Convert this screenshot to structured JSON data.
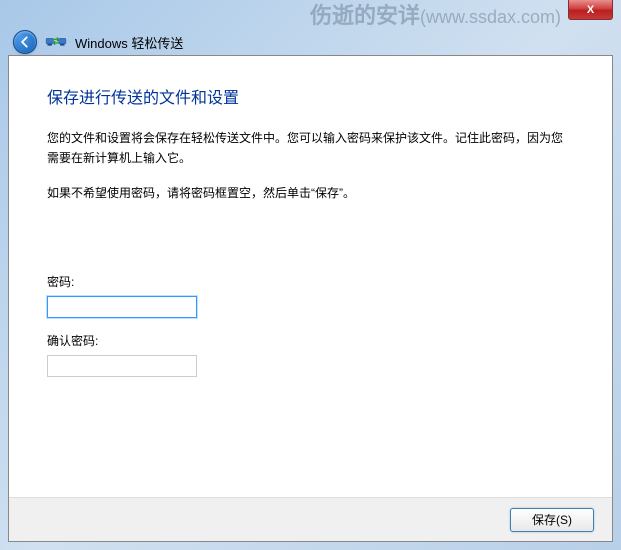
{
  "watermark": {
    "text": "伤逝的安详",
    "url": "(www.ssdax.com)"
  },
  "window": {
    "close_label": "X"
  },
  "toolbar": {
    "app_title": "Windows 轻松传送"
  },
  "content": {
    "heading": "保存进行传送的文件和设置",
    "para1": "您的文件和设置将会保存在轻松传送文件中。您可以输入密码来保护该文件。记住此密码，因为您需要在新计算机上输入它。",
    "para2": "如果不希望使用密码，请将密码框置空，然后单击“保存”。"
  },
  "form": {
    "password_label": "密码:",
    "password_value": "",
    "confirm_label": "确认密码:",
    "confirm_value": ""
  },
  "footer": {
    "save_label": "保存(S)"
  }
}
